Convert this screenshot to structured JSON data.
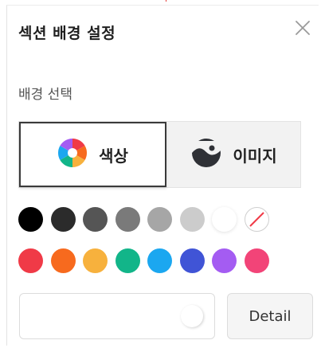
{
  "panel": {
    "title": "섹션 배경 설정",
    "close_icon": "close-icon",
    "subtitle": "배경 선택"
  },
  "background_type": {
    "selected": "color",
    "options": [
      {
        "label": "색상",
        "icon": "color-wheel-icon"
      },
      {
        "label": "이미지",
        "icon": "image-icon"
      }
    ]
  },
  "palette": {
    "row1": [
      "#000000",
      "#2b2b2b",
      "#555555",
      "#7a7a7a",
      "#a6a6a6",
      "#cccccc",
      "#ffffff",
      "none"
    ],
    "row2": [
      "#f03a47",
      "#f76a1e",
      "#f7b13d",
      "#12b589",
      "#1ba7f0",
      "#4054d6",
      "#a45cf2",
      "#f24478"
    ]
  },
  "color_input": {
    "value": "",
    "detail_label": "Detail"
  }
}
